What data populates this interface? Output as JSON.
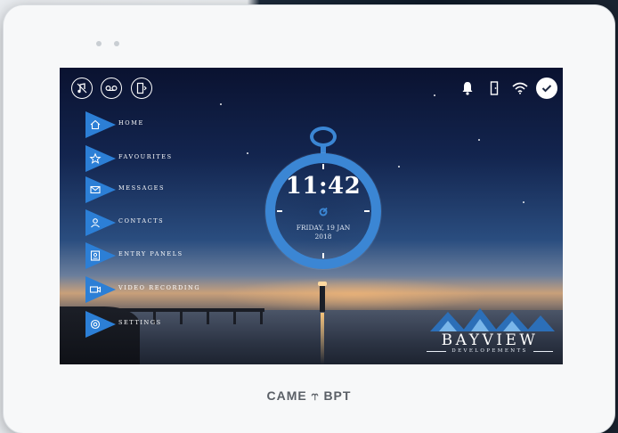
{
  "device": {
    "brand": "CAME ⥾ BPT"
  },
  "top_bar": {
    "left_icons": [
      "music-mute-icon",
      "voicemail-icon",
      "door-open-icon"
    ],
    "right_icons": [
      "bell-icon",
      "door-status-icon",
      "wifi-icon",
      "check-icon"
    ]
  },
  "menu": {
    "items": [
      {
        "label": "HOME",
        "icon": "home-icon"
      },
      {
        "label": "FAVOURITES",
        "icon": "star-icon"
      },
      {
        "label": "MESSAGES",
        "icon": "envelope-icon"
      },
      {
        "label": "CONTACTS",
        "icon": "person-icon"
      },
      {
        "label": "ENTRY PANELS",
        "icon": "entry-panel-icon"
      },
      {
        "label": "VIDEO RECORDING",
        "icon": "video-camera-icon"
      },
      {
        "label": "SETTINGS",
        "icon": "gear-icon"
      }
    ]
  },
  "clock": {
    "time": "11:42",
    "date_line1": "FRIDAY, 19 JAN",
    "date_line2": "2018"
  },
  "logo": {
    "name": "BAYVIEW",
    "subtitle": "DEVELOPEMENTS"
  },
  "colors": {
    "accent": "#2c7fd6",
    "clock_ring": "#3b86d4"
  }
}
